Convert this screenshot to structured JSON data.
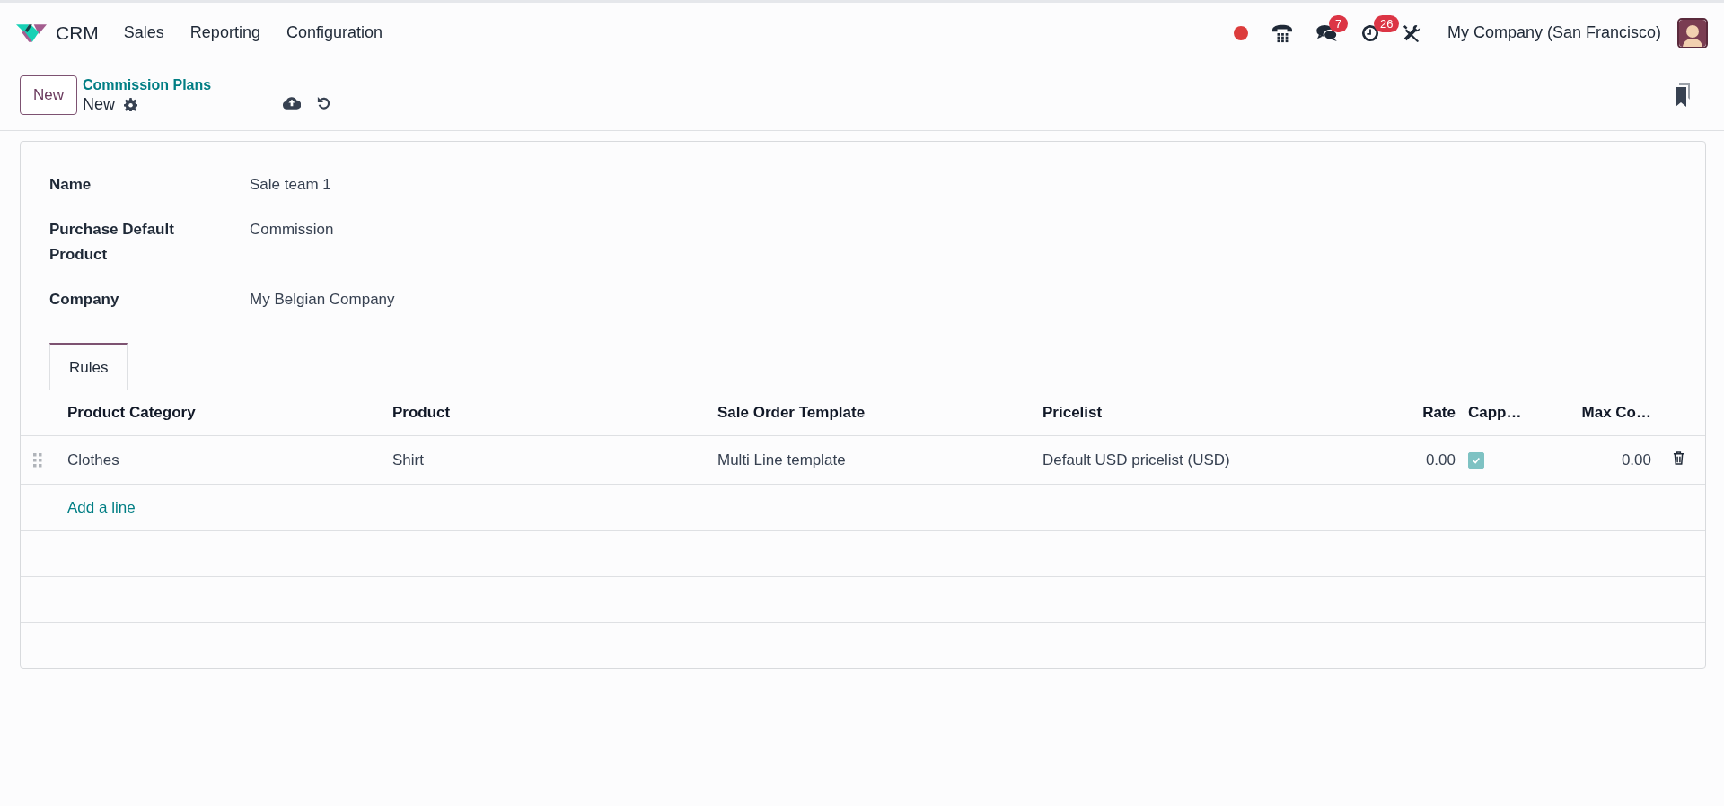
{
  "navbar": {
    "app_name": "CRM",
    "menu": [
      {
        "label": "Sales"
      },
      {
        "label": "Reporting"
      },
      {
        "label": "Configuration"
      }
    ],
    "systray": [
      {
        "kind": "dot"
      },
      {
        "kind": "phone"
      },
      {
        "kind": "chat",
        "badge": "7"
      },
      {
        "kind": "clock",
        "badge": "26"
      },
      {
        "kind": "tools"
      }
    ],
    "company": "My Company (San Francisco)"
  },
  "control_panel": {
    "new_button": "New",
    "breadcrumb": "Commission Plans",
    "record_name": "New"
  },
  "form": {
    "fields": [
      {
        "label": "Name",
        "value": "Sale team 1"
      },
      {
        "label": "Purchase Default Product",
        "value": "Commission"
      },
      {
        "label": "Company",
        "value": "My Belgian Company"
      }
    ]
  },
  "tabs": [
    {
      "label": "Rules",
      "selected": true
    }
  ],
  "table": {
    "columns": [
      "Product Category",
      "Product",
      "Sale Order Template",
      "Pricelist",
      "Rate",
      "Capp…",
      "Max Co…"
    ],
    "rows": [
      {
        "product_category": "Clothes",
        "product": "Shirt",
        "sale_order_template": "Multi Line template",
        "pricelist": "Default USD pricelist (USD)",
        "rate": "0.00",
        "capped": true,
        "max_commission": "0.00"
      }
    ],
    "add_line": "Add a line"
  }
}
